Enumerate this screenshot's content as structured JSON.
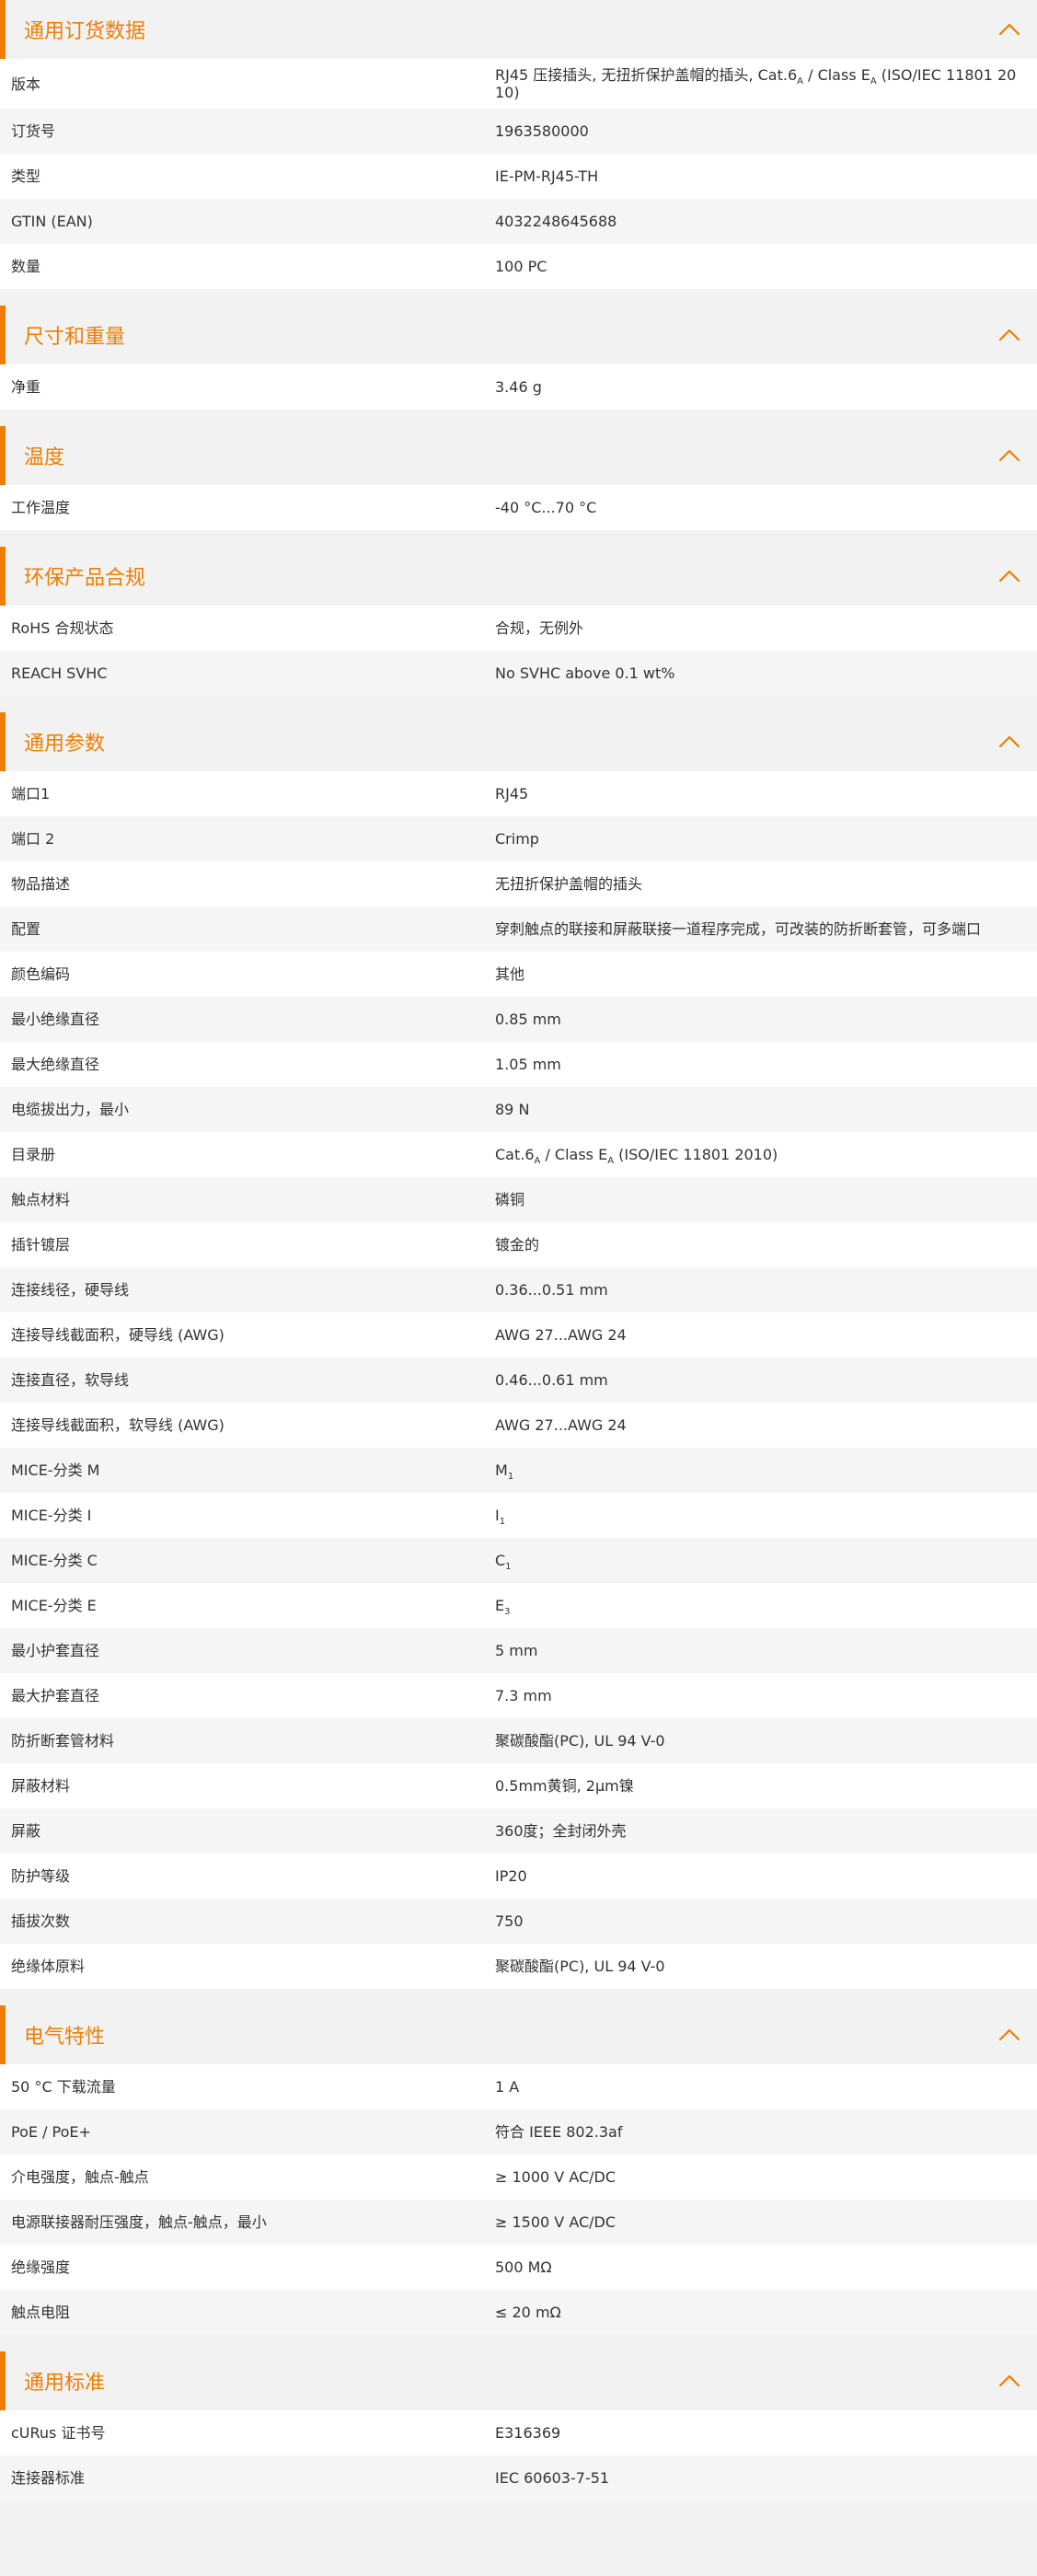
{
  "accent_color": "#f07d00",
  "collapse_icon": "chevron-up-icon",
  "sections": [
    {
      "title": "通用订货数据",
      "rows": [
        {
          "label": "版本",
          "value": "RJ45 压接插头, 无扭折保护盖帽的插头, Cat.6<sub>A</sub> / Class E<sub>A</sub> (ISO/IEC 11801 2010)"
        },
        {
          "label": "订货号",
          "value": "1963580000"
        },
        {
          "label": "类型",
          "value": "IE-PM-RJ45-TH"
        },
        {
          "label": "GTIN (EAN)",
          "value": "4032248645688"
        },
        {
          "label": "数量",
          "value": "100  PC"
        }
      ]
    },
    {
      "title": "尺寸和重量",
      "rows": [
        {
          "label": "净重",
          "value": "3.46  g"
        }
      ]
    },
    {
      "title": "温度",
      "rows": [
        {
          "label": "工作温度",
          "value": "-40 °C...70 °C"
        }
      ]
    },
    {
      "title": "环保产品合规",
      "rows": [
        {
          "label": "RoHS 合规状态",
          "value": "合规，无例外"
        },
        {
          "label": "REACH SVHC",
          "value": "No SVHC above 0.1 wt%"
        }
      ]
    },
    {
      "title": "通用参数",
      "rows": [
        {
          "label": "端口1",
          "value": "RJ45"
        },
        {
          "label": "端口 2",
          "value": "Crimp"
        },
        {
          "label": "物品描述",
          "value": "无扭折保护盖帽的插头"
        },
        {
          "label": "配置",
          "value": "穿刺触点的联接和屏蔽联接一道程序完成，可改装的防折断套管，可多端口"
        },
        {
          "label": "颜色编码",
          "value": "其他"
        },
        {
          "label": "最小绝缘直径",
          "value": "0.85  mm"
        },
        {
          "label": "最大绝缘直径",
          "value": "1.05  mm"
        },
        {
          "label": "电缆拔出力，最小",
          "value": "89  N"
        },
        {
          "label": "目录册",
          "value": "Cat.6<sub>A</sub> / Class E<sub>A</sub> (ISO/IEC 11801 2010)"
        },
        {
          "label": "触点材料",
          "value": "磷铜"
        },
        {
          "label": "插针镀层",
          "value": "镀金的"
        },
        {
          "label": "连接线径，硬导线",
          "value": "0.36...0.51 mm"
        },
        {
          "label": "连接导线截面积，硬导线 (AWG)",
          "value": "AWG 27...AWG 24"
        },
        {
          "label": "连接直径，软导线",
          "value": "0.46...0.61 mm"
        },
        {
          "label": "连接导线截面积，软导线 (AWG)",
          "value": "AWG 27...AWG 24"
        },
        {
          "label": "MICE-分类 M",
          "value": "M<sub>1</sub>"
        },
        {
          "label": "MICE-分类 I",
          "value": "I<sub>1</sub>"
        },
        {
          "label": "MICE-分类 C",
          "value": "C<sub>1</sub>"
        },
        {
          "label": "MICE-分类 E",
          "value": "E<sub>3</sub>"
        },
        {
          "label": "最小护套直径",
          "value": "5  mm"
        },
        {
          "label": "最大护套直径",
          "value": "7.3  mm"
        },
        {
          "label": "防折断套管材料",
          "value": "聚碳酸酯(PC), UL 94 V-0"
        },
        {
          "label": "屏蔽材料",
          "value": "0.5mm黄铜, 2µm镍"
        },
        {
          "label": "屏蔽",
          "value": "360度；全封闭外壳"
        },
        {
          "label": "防护等级",
          "value": "IP20"
        },
        {
          "label": "插拔次数",
          "value": "750"
        },
        {
          "label": "绝缘体原料",
          "value": "聚碳酸酯(PC), UL 94 V-0"
        }
      ]
    },
    {
      "title": "电气特性",
      "rows": [
        {
          "label": "50 °C 下载流量",
          "value": "1  A"
        },
        {
          "label": "PoE / PoE+",
          "value": "符合 IEEE 802.3af"
        },
        {
          "label": "介电强度，触点-触点",
          "value": "≥ 1000 V AC/DC"
        },
        {
          "label": "电源联接器耐压强度，触点-触点，最小",
          "value": "≥ 1500 V AC/DC"
        },
        {
          "label": "绝缘强度",
          "value": "500 MΩ"
        },
        {
          "label": "触点电阻",
          "value": "≤ 20 mΩ"
        }
      ]
    },
    {
      "title": "通用标准",
      "rows": [
        {
          "label": "cURus 证书号",
          "value": "E316369"
        },
        {
          "label": "连接器标准",
          "value": "IEC 60603-7-51"
        }
      ]
    }
  ]
}
